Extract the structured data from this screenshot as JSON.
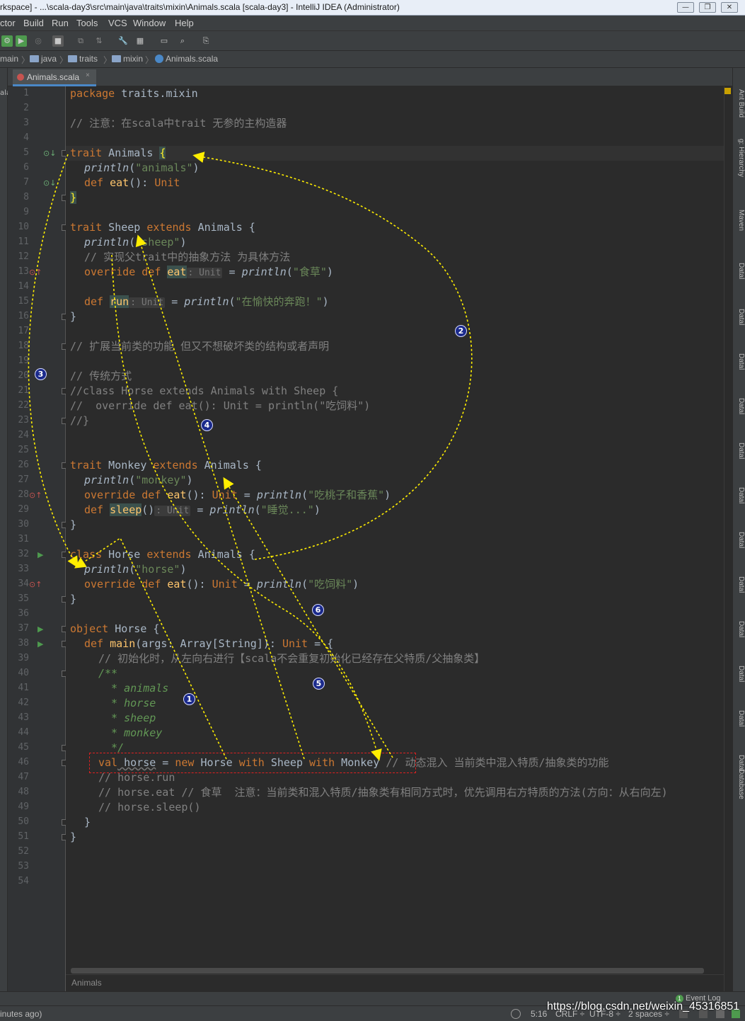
{
  "window": {
    "title": "rkspace] - ...\\scala-day3\\src\\main\\java\\traits\\mixin\\Animals.scala [scala-day3] - IntelliJ IDEA (Administrator)"
  },
  "menu": {
    "items": [
      "ctor",
      "Build",
      "Run",
      "Tools",
      "VCS",
      "Window",
      "Help"
    ]
  },
  "breadcrumbs": [
    "main",
    "java",
    "traits",
    "mixin",
    "Animals.scala"
  ],
  "tab": {
    "label": "Animals.scala",
    "close": "×"
  },
  "left_strip_label": "ala",
  "editor": {
    "line_numbers": [
      "1",
      "2",
      "3",
      "4",
      "5",
      "6",
      "7",
      "8",
      "9",
      "10",
      "11",
      "12",
      "13",
      "14",
      "15",
      "16",
      "17",
      "18",
      "19",
      "20",
      "21",
      "22",
      "23",
      "24",
      "25",
      "26",
      "27",
      "28",
      "29",
      "30",
      "31",
      "32",
      "33",
      "34",
      "35",
      "36",
      "37",
      "38",
      "39",
      "40",
      "41",
      "42",
      "43",
      "44",
      "45",
      "46",
      "47",
      "48",
      "49",
      "50",
      "51",
      "52",
      "53",
      "54"
    ],
    "code": {
      "l1_kw": "package",
      "l1_t": " traits.mixin",
      "l3": "// 注意：在scala中trait 无参的主构造器",
      "l5_kw": "trait",
      "l5_t": " Animals ",
      "l5_b": "{",
      "l6_fn": "println",
      "l6_p1": "(",
      "l6_s": "\"animals\"",
      "l6_p2": ")",
      "l7_kw": "def",
      "l7_fn": " eat",
      "l7_t": "(): ",
      "l7_kw2": "Unit",
      "l8_b": "}",
      "l10_kw": "trait",
      "l10_t": " Sheep ",
      "l10_kw2": "extends",
      "l10_t2": " Animals {",
      "l11_fn": "println",
      "l11_p1": "(",
      "l11_s": "\"sheep\"",
      "l11_p2": ")",
      "l12": "// 实现父trait中的抽象方法 为具体方法",
      "l13_kw": "override def",
      "l13_fn": "eat",
      "l13_h": ": Unit",
      "l13_t": " = ",
      "l13_fn2": "println",
      "l13_p1": "(",
      "l13_s": "\"食草\"",
      "l13_p2": ")",
      "l15_kw": "def",
      "l15_fn": "run",
      "l15_h": ": Unit",
      "l15_t": " = ",
      "l15_fn2": "println",
      "l15_p1": "(",
      "l15_s": "\"在愉快的奔跑！\"",
      "l15_p2": ")",
      "l16_b": "}",
      "l18": "// 扩展当前类的功能 但又不想破坏类的结构或者声明",
      "l20": "// 传统方式",
      "l21": "//class Horse extends Animals with Sheep {",
      "l22": "//  override def eat(): Unit = println(\"吃饲料\")",
      "l23": "//}",
      "l26_kw": "trait",
      "l26_t": " Monkey ",
      "l26_kw2": "extends",
      "l26_t2": " Animals {",
      "l27_fn": "println",
      "l27_p1": "(",
      "l27_s": "\"monkey\"",
      "l27_p2": ")",
      "l28_kw": "override def",
      "l28_fn": " eat",
      "l28_t": "(): ",
      "l28_kw2": "Unit",
      "l28_t2": " = ",
      "l28_fn2": "println",
      "l28_p1": "(",
      "l28_s": "\"吃桃子和香蕉\"",
      "l28_p2": ")",
      "l29_kw": "def",
      "l29_fn": "sleep",
      "l29_t": "()",
      "l29_h": ": Unit",
      "l29_t2": " = ",
      "l29_fn2": "println",
      "l29_p1": "(",
      "l29_s": "\"睡觉...\"",
      "l29_p2": ")",
      "l30_b": "}",
      "l32_kw": "class",
      "l32_t": " Horse ",
      "l32_kw2": "extends",
      "l32_t2": " Animals {",
      "l33_fn": "println",
      "l33_p1": "(",
      "l33_s": "\"horse\"",
      "l33_p2": ")",
      "l34_kw": "override def",
      "l34_fn": " eat",
      "l34_t": "(): ",
      "l34_kw2": "Unit",
      "l34_t2": " = ",
      "l34_fn2": "println",
      "l34_p1": "(",
      "l34_s": "\"吃饲料\"",
      "l34_p2": ")",
      "l35_b": "}",
      "l37_kw": "object",
      "l37_t": " Horse {",
      "l38_kw": "def",
      "l38_fn": " main",
      "l38_t": "(args: Array[String]): ",
      "l38_kw2": "Unit",
      "l38_t2": " = {",
      "l39": "// 初始化时，从左向右进行【scala不会重复初始化已经存在父特质/父抽象类】",
      "l40": "/**",
      "l41": "  * animals",
      "l42": "  * horse",
      "l43": "  * sheep",
      "l44": "  * monkey",
      "l45": "  */",
      "l46_kw": "val",
      "l46_t": " horse",
      "l46_t2": " = ",
      "l46_kw2": "new",
      "l46_t3": " Horse ",
      "l46_kw3": "with",
      "l46_t4": " Sheep ",
      "l46_kw4": "with",
      "l46_t5": " Monkey ",
      "l46_c": "// 动态混入 当前类中混入特质/抽象类的功能",
      "l47": "// horse.run",
      "l48": "// horse.eat // 食草  注意：当前类和混入特质/抽象类有相同方式时，优先调用右方特质的方法(方向：从右向左)",
      "l49": "// horse.sleep()",
      "l50_b": "}",
      "l51_b": "}"
    }
  },
  "right_tools": [
    "Ant Build",
    "g: Hierarchy",
    "Maven",
    "Datal",
    "Datal",
    "Datal",
    "Datal",
    "Datal",
    "Datal",
    "Datal",
    "Datal",
    "Datal",
    "Datal",
    "Datal",
    "Datal",
    "Database"
  ],
  "footer_crumb": "Animals",
  "status": {
    "left": "inutes ago)",
    "position": "5:16",
    "line_sep": "CRLF ÷",
    "encoding": "UTF-8 ÷",
    "indent": "2 spaces ÷",
    "event_log": "Event Log",
    "event_count": "1"
  },
  "watermark": "https://blog.csdn.net/weixin_45316851",
  "annotations": [
    "1",
    "2",
    "3",
    "4",
    "5",
    "6"
  ],
  "colors": {
    "arrow": "#ffee00",
    "badge": "#1b2a8c",
    "keyword": "#cc7832",
    "string": "#6a8759",
    "comment": "#808080",
    "doc": "#629755"
  }
}
